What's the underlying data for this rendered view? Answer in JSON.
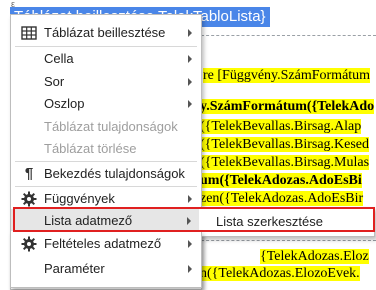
{
  "document": {
    "top_mark": "ε",
    "selected_title": "Táblázat beillesztése TelekTabloLista}",
    "lines": [
      "re [Függvény.SzámFormátum",
      "y.SzámFormátum({TelekAdo",
      "({TelekBevallas.Birsag.Alap",
      "({TelekBevallas.Birsag.Kesed",
      "({TelekBevallas.Birsag.Mulas",
      "um({TelekAdozas.AdoEsBi",
      "zen({TelekAdozas.AdoEsBir",
      "{TelekAdozas.Eloz",
      "n({TelekAdozas.ElozoEvek."
    ]
  },
  "menu": {
    "items": [
      {
        "label": "Táblázat beillesztése",
        "icon": "table-grid-icon",
        "submenu": true,
        "disabled": false
      },
      {
        "label": "Cella",
        "icon": "",
        "submenu": true,
        "disabled": false
      },
      {
        "label": "Sor",
        "icon": "",
        "submenu": true,
        "disabled": false
      },
      {
        "label": "Oszlop",
        "icon": "",
        "submenu": true,
        "disabled": false
      },
      {
        "label": "Táblázat tulajdonságok",
        "icon": "",
        "submenu": false,
        "disabled": true
      },
      {
        "label": "Táblázat törlése",
        "icon": "",
        "submenu": false,
        "disabled": true
      },
      {
        "label": "Bekezdés tulajdonságok",
        "icon": "pilcrow-icon",
        "submenu": false,
        "disabled": false
      },
      {
        "label": "Függvények",
        "icon": "gear-icon",
        "submenu": true,
        "disabled": false
      },
      {
        "label": "Lista adatmező",
        "icon": "",
        "submenu": true,
        "disabled": false,
        "active": true
      },
      {
        "label": "Feltételes adatmező",
        "icon": "gear-icon",
        "submenu": true,
        "disabled": false
      },
      {
        "label": "Paraméter",
        "icon": "",
        "submenu": true,
        "disabled": false
      }
    ]
  },
  "submenu": {
    "items": [
      {
        "label": "Lista szerkesztése"
      }
    ]
  },
  "colors": {
    "highlight_border": "#e02020",
    "selection_blue": "#4a86e8",
    "doc_highlight": "#ffff00"
  }
}
